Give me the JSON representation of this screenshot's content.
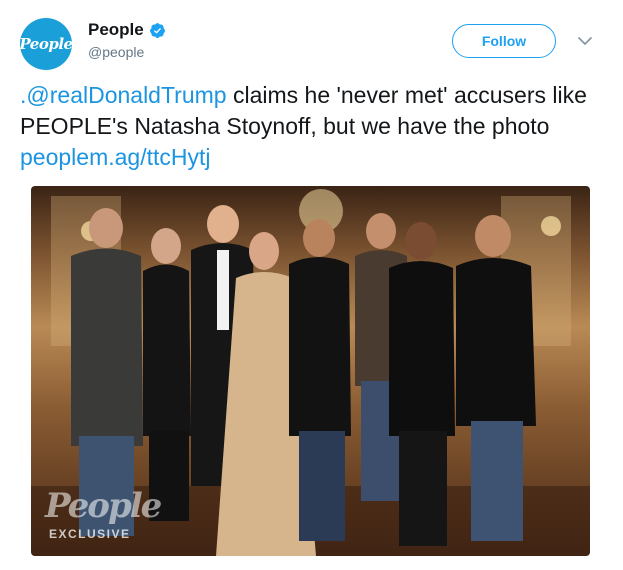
{
  "account": {
    "display_name": "People",
    "handle": "@people",
    "avatar_text": "People",
    "verified": true
  },
  "actions": {
    "follow_label": "Follow",
    "more_icon": "chevron-down-icon"
  },
  "tweet": {
    "mention": ".@realDonaldTrump",
    "text_1": " claims he 'never met' accusers like PEOPLE's Natasha Stoynoff, but we have the photo ",
    "link": "peoplem.ag/ttcHytj"
  },
  "photo": {
    "watermark": "People",
    "badge": "EXCLUSIVE"
  },
  "colors": {
    "accent": "#1da1f2",
    "link": "#1b95e0",
    "avatar_bg": "#1a9fd9"
  }
}
